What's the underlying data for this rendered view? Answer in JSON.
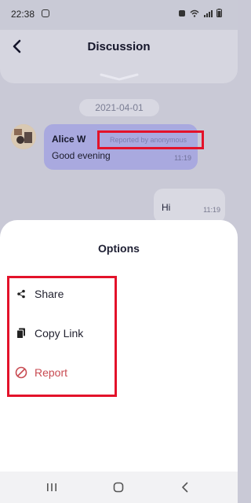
{
  "status_bar": {
    "time": "22:38"
  },
  "header": {
    "title": "Discussion"
  },
  "chat": {
    "date": "2021-04-01",
    "messages": [
      {
        "sender": "Alice W",
        "reported_label": "Reported by anonymous",
        "text": "Good evening",
        "time": "11:19"
      },
      {
        "text": "Hi",
        "time": "11:19"
      }
    ]
  },
  "sheet": {
    "title": "Options",
    "options": [
      {
        "label": "Share",
        "icon": "share-icon"
      },
      {
        "label": "Copy Link",
        "icon": "copy-icon"
      },
      {
        "label": "Report",
        "icon": "report-icon",
        "color": "#c84b52"
      }
    ]
  },
  "colors": {
    "highlight": "#e3122a",
    "bubble_left": "#a9a9df",
    "sheet_bg": "#ffffff"
  },
  "nav": {
    "icons": [
      "recents-icon",
      "home-icon",
      "back-icon"
    ]
  }
}
